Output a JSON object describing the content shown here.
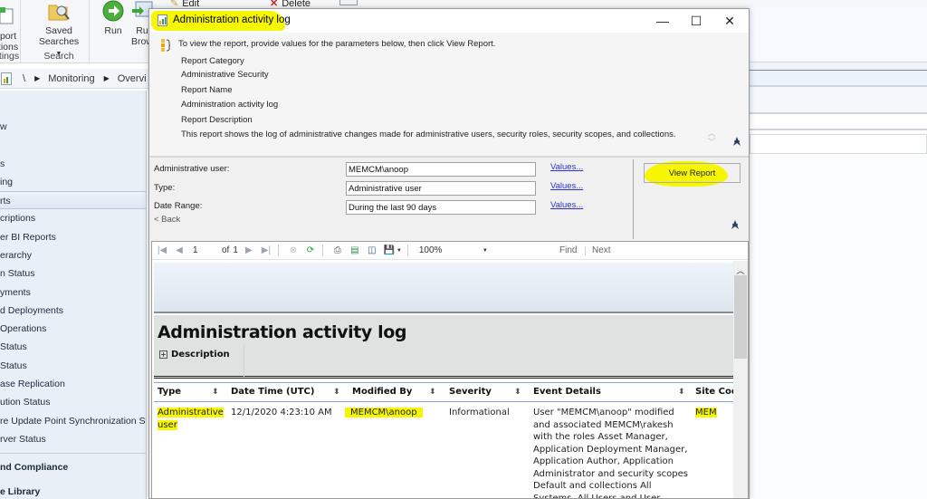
{
  "ribbon": {
    "groups": [
      {
        "label": "ttings",
        "buttons": [
          {
            "label_line1": "port",
            "label_line2": "tions",
            "icon": "report-options-icon"
          }
        ]
      },
      {
        "label": "Search",
        "buttons": [
          {
            "label_line1": "Saved",
            "label_line2": "Searches",
            "icon": "saved-searches-icon"
          }
        ]
      },
      {
        "label": "",
        "buttons": [
          {
            "label_line1": "Run",
            "label_line2": "",
            "icon": "run-icon"
          },
          {
            "label_line1": "Ru",
            "label_line2": "Brow",
            "icon": "run-browser-icon"
          }
        ]
      }
    ],
    "edit_label": "Edit",
    "delete_label": "Delete"
  },
  "addressbar": {
    "root": "\\",
    "crumbs": [
      "Monitoring",
      "Overvi"
    ]
  },
  "nav": {
    "items": [
      {
        "label": "w",
        "selected": false,
        "section": false
      },
      {
        "label": "s",
        "selected": false,
        "section": false
      },
      {
        "label": "ing",
        "selected": false,
        "section": false
      },
      {
        "label": "rts",
        "selected": true,
        "section": false
      },
      {
        "label": "criptions",
        "selected": false,
        "section": false
      },
      {
        "label": "er BI Reports",
        "selected": false,
        "section": false
      },
      {
        "label": "erarchy",
        "selected": false,
        "section": false
      },
      {
        "label": "n Status",
        "selected": false,
        "section": false
      },
      {
        "label": "yments",
        "selected": false,
        "section": false
      },
      {
        "label": "d Deployments",
        "selected": false,
        "section": false
      },
      {
        "label": "Operations",
        "selected": false,
        "section": false
      },
      {
        "label": "Status",
        "selected": false,
        "section": false
      },
      {
        "label": "Status",
        "selected": false,
        "section": false
      },
      {
        "label": "ase Replication",
        "selected": false,
        "section": false
      },
      {
        "label": "ution Status",
        "selected": false,
        "section": false
      },
      {
        "label": "re Update Point Synchronization Sta",
        "selected": false,
        "section": false
      },
      {
        "label": "rver Status",
        "selected": false,
        "section": false
      }
    ],
    "sections": [
      "nd Compliance",
      "e Library"
    ]
  },
  "dialog": {
    "title": "Administration activity log",
    "window_buttons": {
      "minimize": "—",
      "maximize": "☐",
      "close": "✕"
    },
    "info_message": "To view the report, provide values for the parameters below, then click View Report.",
    "report_category_label": "Report Category",
    "report_category_value": "Administrative Security",
    "report_name_label": "Report Name",
    "report_name_value": "Administration activity log",
    "report_description_label": "Report Description",
    "report_description_value": "This report shows the log of administrative changes made for administrative users, security roles, security scopes, and collections.",
    "params": [
      {
        "label": "Administrative user:",
        "value": "MEMCM\\anoop",
        "link": "Values..."
      },
      {
        "label": "Type:",
        "value": "Administrative user",
        "link": "Values..."
      },
      {
        "label": "Date Range:",
        "value": "During the last 90 days",
        "link": "Values..."
      }
    ],
    "back_label": "< Back",
    "view_report_label": "View Report"
  },
  "viewer": {
    "toolbar": {
      "page_current": "1",
      "page_of": "of",
      "page_total": "1",
      "zoom": "100%",
      "find_label": "Find",
      "next_label": "Next"
    },
    "report_title": "Administration activity log",
    "description_toggle": "Description",
    "table": {
      "columns": [
        "Type",
        "Date Time (UTC)",
        "Modified By",
        "Severity",
        "Event Details",
        "Site Code"
      ],
      "rows": [
        {
          "type": "Administrative user",
          "datetime": "12/1/2020 4:23:10 AM",
          "modified_by": "MEMCM\\anoop",
          "severity": "Informational",
          "event_details": "User \"MEMCM\\anoop\" modified and associated MEMCM\\rakesh with the roles Asset Manager, Application Deployment Manager, Application Author, Application Administrator and security scopes Default and collections All Systems, All Users and User",
          "site_code": "MEM"
        }
      ]
    }
  },
  "colors": {
    "highlight": "#f6f600",
    "link": "#2d32d2",
    "nav_bg": "#e9eff7",
    "dialog_bg": "#f0f0f0"
  }
}
